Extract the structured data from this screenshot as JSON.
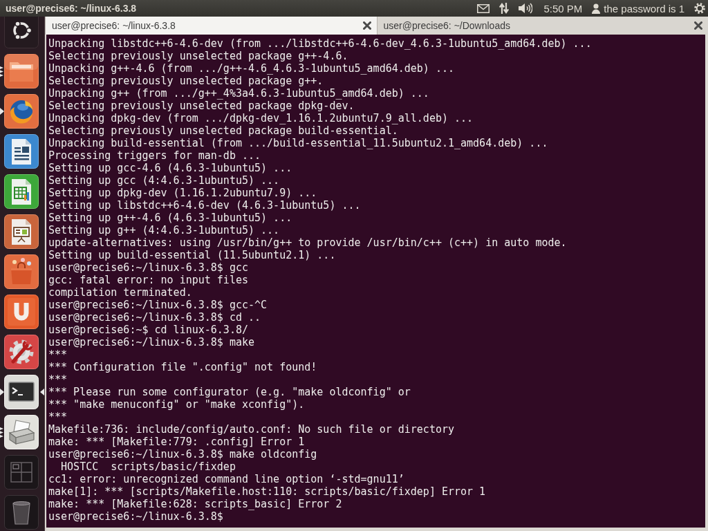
{
  "top_panel": {
    "title": "user@precise6: ~/linux-6.3.8",
    "clock": "5:50 PM",
    "user": "the password is 1"
  },
  "launcher": {
    "items": [
      {
        "kind": "dash",
        "running": false,
        "focused": false
      },
      {
        "kind": "files",
        "running": true,
        "multiple_windows": true,
        "focused": false
      },
      {
        "kind": "browser",
        "running": true,
        "multiple_windows": false,
        "focused": false
      },
      {
        "kind": "writer",
        "running": false,
        "focused": false
      },
      {
        "kind": "calc",
        "running": false,
        "focused": false
      },
      {
        "kind": "impress",
        "running": false,
        "focused": false
      },
      {
        "kind": "software",
        "running": false,
        "focused": false
      },
      {
        "kind": "u",
        "running": false,
        "focused": false
      },
      {
        "kind": "settings",
        "running": false,
        "focused": false
      },
      {
        "kind": "terminal",
        "running": true,
        "multiple_windows": false,
        "focused": true
      },
      {
        "kind": "printer",
        "running": true,
        "multiple_windows": true,
        "focused": false
      },
      {
        "kind": "workspaces",
        "running": false,
        "focused": false
      },
      {
        "kind": "trash",
        "running": false,
        "focused": false
      }
    ]
  },
  "tabs": [
    {
      "label": "user@precise6: ~/linux-6.3.8",
      "selected": true
    },
    {
      "label": "user@precise6: ~/Downloads",
      "selected": false
    }
  ],
  "terminal": {
    "lines": [
      "Unpacking libstdc++6-4.6-dev (from .../libstdc++6-4.6-dev_4.6.3-1ubuntu5_amd64.deb) ...",
      "Selecting previously unselected package g++-4.6.",
      "Unpacking g++-4.6 (from .../g++-4.6_4.6.3-1ubuntu5_amd64.deb) ...",
      "Selecting previously unselected package g++.",
      "Unpacking g++ (from .../g++_4%3a4.6.3-1ubuntu5_amd64.deb) ...",
      "Selecting previously unselected package dpkg-dev.",
      "Unpacking dpkg-dev (from .../dpkg-dev_1.16.1.2ubuntu7.9_all.deb) ...",
      "Selecting previously unselected package build-essential.",
      "Unpacking build-essential (from .../build-essential_11.5ubuntu2.1_amd64.deb) ...",
      "Processing triggers for man-db ...",
      "Setting up gcc-4.6 (4.6.3-1ubuntu5) ...",
      "Setting up gcc (4:4.6.3-1ubuntu5) ...",
      "Setting up dpkg-dev (1.16.1.2ubuntu7.9) ...",
      "Setting up libstdc++6-4.6-dev (4.6.3-1ubuntu5) ...",
      "Setting up g++-4.6 (4.6.3-1ubuntu5) ...",
      "Setting up g++ (4:4.6.3-1ubuntu5) ...",
      "update-alternatives: using /usr/bin/g++ to provide /usr/bin/c++ (c++) in auto mode.",
      "Setting up build-essential (11.5ubuntu2.1) ...",
      "user@precise6:~/linux-6.3.8$ gcc",
      "gcc: fatal error: no input files",
      "compilation terminated.",
      "user@precise6:~/linux-6.3.8$ gcc-^C",
      "user@precise6:~/linux-6.3.8$ cd ..",
      "user@precise6:~$ cd linux-6.3.8/",
      "user@precise6:~/linux-6.3.8$ make",
      "***",
      "*** Configuration file \".config\" not found!",
      "***",
      "*** Please run some configurator (e.g. \"make oldconfig\" or",
      "*** \"make menuconfig\" or \"make xconfig\").",
      "***",
      "Makefile:736: include/config/auto.conf: No such file or directory",
      "make: *** [Makefile:779: .config] Error 1",
      "user@precise6:~/linux-6.3.8$ make oldconfig",
      "  HOSTCC  scripts/basic/fixdep",
      "cc1: error: unrecognized command line option ‘-std=gnu11’",
      "make[1]: *** [scripts/Makefile.host:110: scripts/basic/fixdep] Error 1",
      "make: *** [Makefile:628: scripts_basic] Error 2",
      "user@precise6:~/linux-6.3.8$"
    ]
  }
}
